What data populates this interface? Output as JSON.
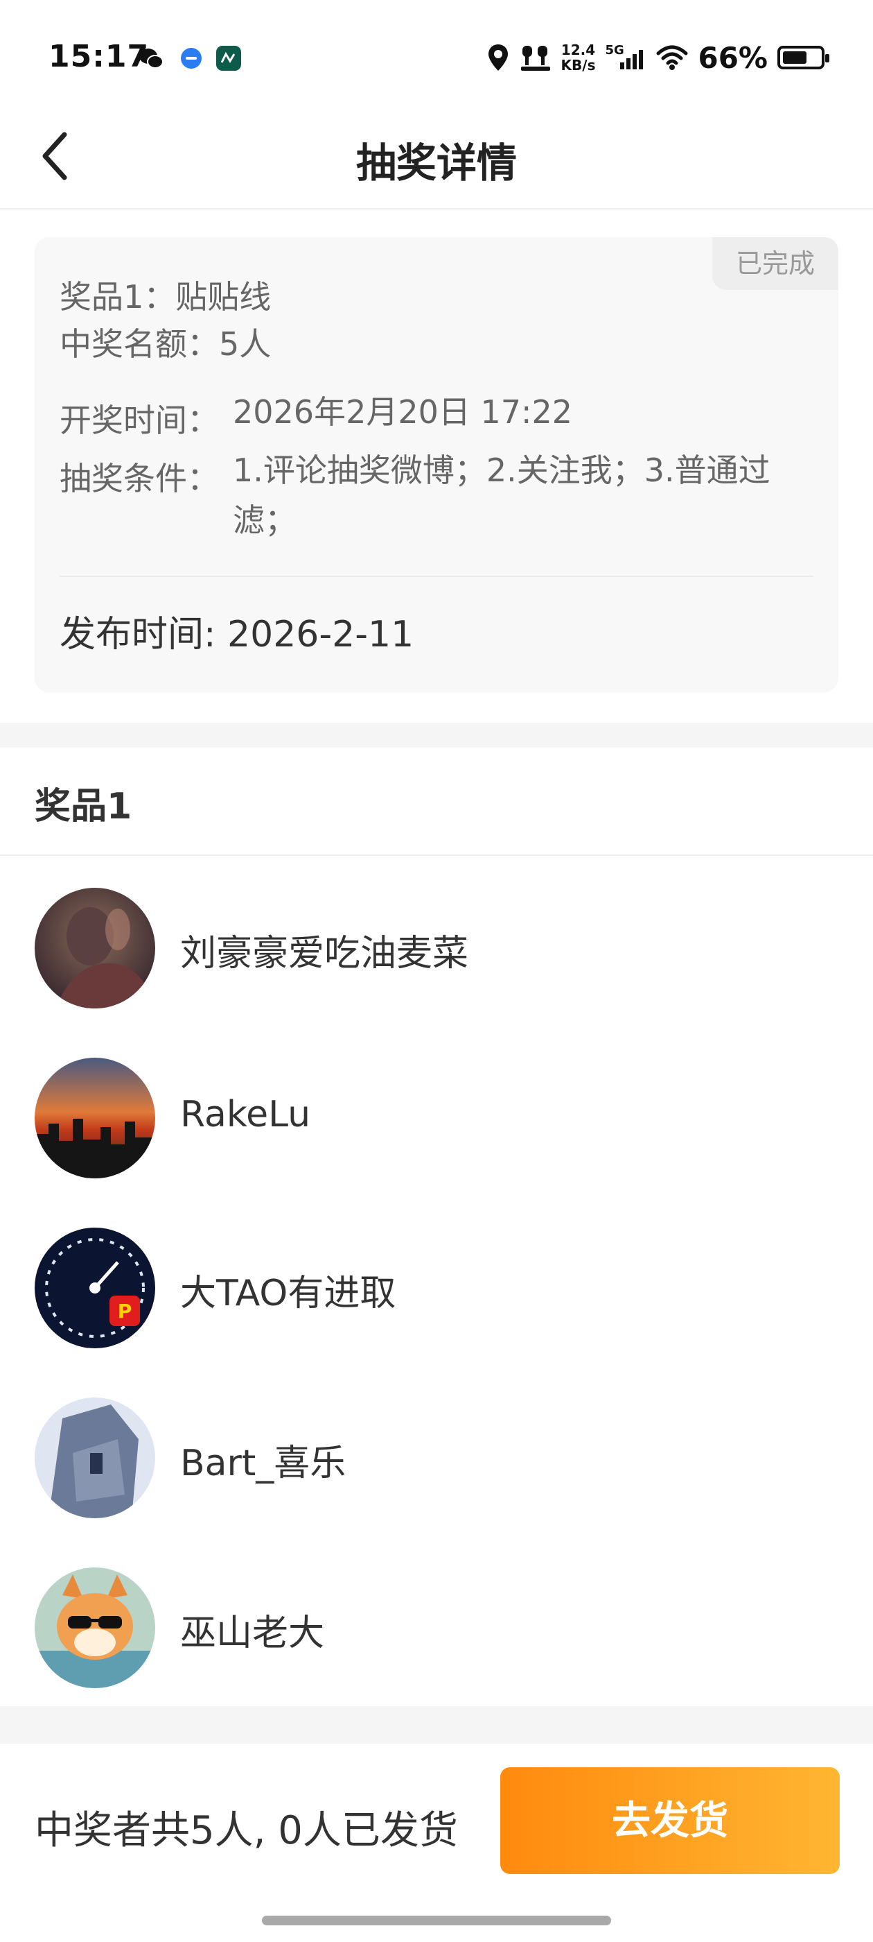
{
  "status_bar": {
    "time": "15:17",
    "net_speed_value": "12.4",
    "net_speed_unit": "KB/s",
    "network_type": "5G",
    "battery_text": "66%",
    "battery_level": 0.66,
    "icons": [
      "wechat-icon",
      "message-app-icon",
      "shop-app-icon",
      "location-icon",
      "earbuds-icon",
      "signal-icon",
      "wifi-icon",
      "battery-icon"
    ]
  },
  "nav": {
    "title": "抽奖详情"
  },
  "info": {
    "status": "已完成",
    "prize_line": "奖品1：贴贴线",
    "quota_line": "中奖名额：5人",
    "draw_time_label": "开奖时间：",
    "draw_time_value": "2026年2月20日 17:22",
    "conditions_label": "抽奖条件：",
    "conditions_value": "1.评论抽奖微博；2.关注我；3.普通过滤；",
    "publish_time": "发布时间: 2026-2-11"
  },
  "prize_section": {
    "title": "奖品1",
    "winners": [
      {
        "name": "刘豪豪爱吃油麦菜"
      },
      {
        "name": "RakeLu"
      },
      {
        "name": "大TAO有进取"
      },
      {
        "name": "Bart_喜乐"
      },
      {
        "name": "巫山老大"
      }
    ]
  },
  "bottom": {
    "summary": "中奖者共5人, 0人已发货",
    "ship_button": "去发货"
  },
  "colors": {
    "accent_start": "#ff8a0e",
    "accent_end": "#ffb632"
  }
}
